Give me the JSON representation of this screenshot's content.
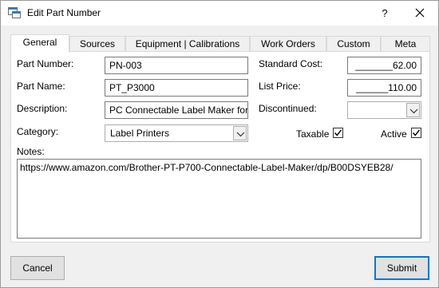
{
  "window": {
    "title": "Edit Part Number",
    "help_label": "?"
  },
  "tabs": [
    {
      "label": "General",
      "active": true
    },
    {
      "label": "Sources"
    },
    {
      "label": "Equipment | Calibrations"
    },
    {
      "label": "Work Orders"
    },
    {
      "label": "Custom"
    },
    {
      "label": "Meta"
    }
  ],
  "form": {
    "part_number_label": "Part Number:",
    "part_number_value": "PN-003",
    "part_name_label": "Part Name:",
    "part_name_value": "PT_P3000",
    "description_label": "Description:",
    "description_value": "PC Connectable Label Maker for",
    "category_label": "Category:",
    "category_value": "Label Printers",
    "standard_cost_label": "Standard Cost:",
    "standard_cost_value": "_______62.00",
    "list_price_label": "List Price:",
    "list_price_value": "______110.00",
    "discontinued_label": "Discontinued:",
    "discontinued_value": "",
    "taxable_label": "Taxable",
    "taxable_checked": true,
    "active_label": "Active",
    "active_checked": true,
    "notes_label": "Notes:",
    "notes_value": "https://www.amazon.com/Brother-PT-P700-Connectable-Label-Maker/dp/B00DSYEB28/"
  },
  "buttons": {
    "cancel_label": "Cancel",
    "submit_label": "Submit"
  },
  "colors": {
    "accent": "#0078d7",
    "window_bg": "#f0f0f0",
    "panel_bg": "#ffffff"
  }
}
